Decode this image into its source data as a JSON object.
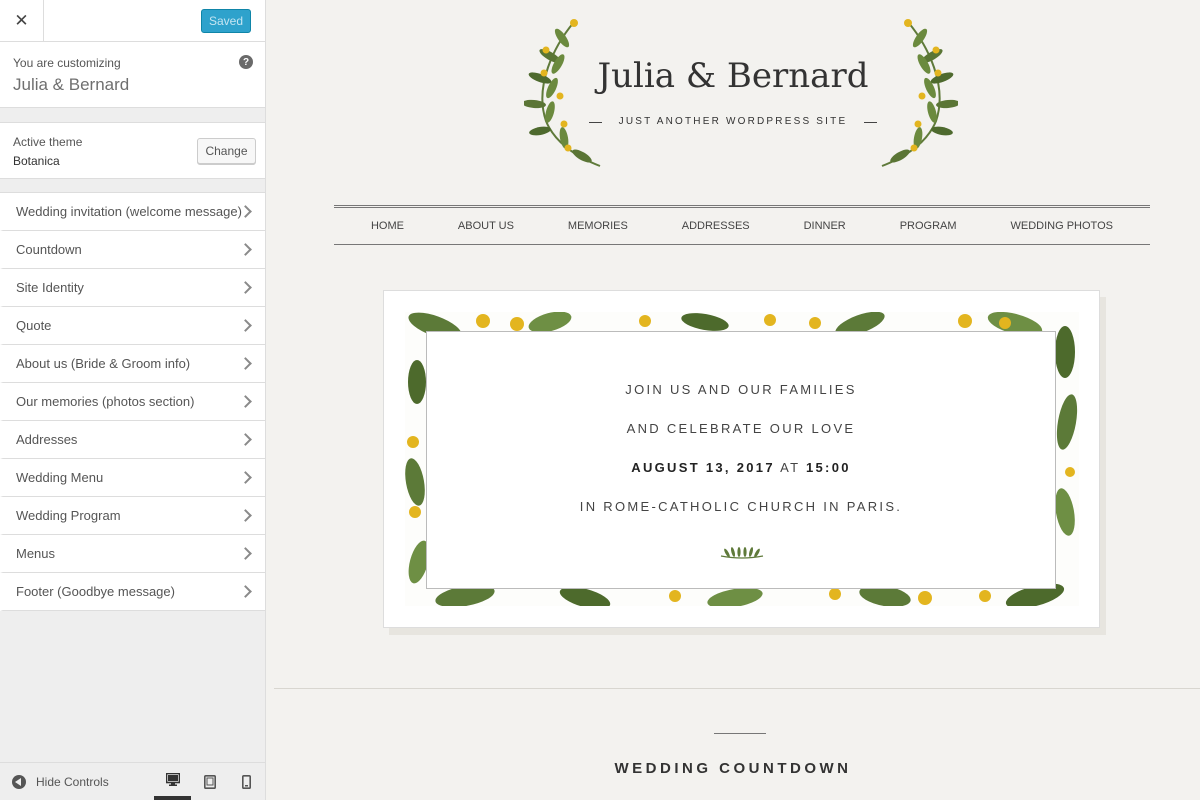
{
  "customizer": {
    "close_icon": "close-icon",
    "saved_label": "Saved",
    "customizing_label": "You are customizing",
    "site_name": "Julia & Bernard",
    "help_icon": "question-icon",
    "active_theme_label": "Active theme",
    "theme_name": "Botanica",
    "change_label": "Change",
    "sections": [
      {
        "label": "Wedding invitation (welcome message)"
      },
      {
        "label": "Countdown"
      },
      {
        "label": "Site Identity"
      },
      {
        "label": "Quote"
      },
      {
        "label": "About us (Bride & Groom info)"
      },
      {
        "label": "Our memories (photos section)"
      },
      {
        "label": "Addresses"
      },
      {
        "label": "Wedding Menu"
      },
      {
        "label": "Wedding Program"
      },
      {
        "label": "Menus"
      },
      {
        "label": "Footer (Goodbye message)"
      }
    ],
    "footer": {
      "hide_controls_label": "Hide Controls",
      "devices": [
        "desktop-icon",
        "tablet-icon",
        "mobile-icon"
      ],
      "active_device": "desktop"
    }
  },
  "preview": {
    "site_title": "Julia & Bernard",
    "tagline": "JUST ANOTHER WORDPRESS SITE",
    "nav": [
      "HOME",
      "ABOUT US",
      "MEMORIES",
      "ADDRESSES",
      "DINNER",
      "PROGRAM",
      "WEDDING PHOTOS"
    ],
    "invitation": {
      "line1": "JOIN US AND OUR FAMILIES",
      "line2": "AND CELEBRATE OUR LOVE",
      "date": "AUGUST 13, 2017",
      "at": "AT",
      "time": "15:00",
      "line4": "IN ROME-CATHOLIC CHURCH IN PARIS."
    },
    "countdown_title": "WEDDING COUNTDOWN"
  },
  "colors": {
    "saved_button": "#2ea2cc",
    "preview_background": "#f3f2ef",
    "leaf_green": "#5f7a3a",
    "flower_yellow": "#e3b51f"
  }
}
